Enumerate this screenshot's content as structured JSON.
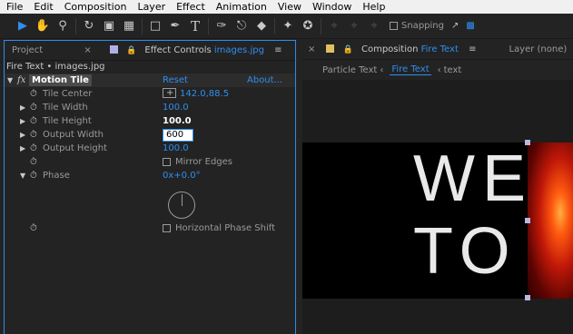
{
  "menu": [
    "File",
    "Edit",
    "Composition",
    "Layer",
    "Effect",
    "Animation",
    "View",
    "Window",
    "Help"
  ],
  "toolbar": {
    "snapping_label": "Snapping"
  },
  "left_panel": {
    "project_tab": "Project",
    "effect_controls_prefix": "Effect Controls",
    "effect_controls_layer": "images.jpg",
    "subheader": "Fire Text • images.jpg",
    "effect": {
      "name": "Motion Tile",
      "reset": "Reset",
      "about": "About..."
    },
    "properties": [
      {
        "label": "Tile Center",
        "value": "142.0,88.5"
      },
      {
        "label": "Tile Width",
        "value": "100.0"
      },
      {
        "label": "Tile Height",
        "value": "100.0"
      },
      {
        "label": "Output Width",
        "value": "600"
      },
      {
        "label": "Output Height",
        "value": "100.0"
      },
      {
        "label": "Mirror Edges"
      },
      {
        "label": "Phase",
        "value": "0x+0.0°"
      },
      {
        "label": "Horizontal Phase Shift"
      }
    ]
  },
  "right_panel": {
    "composition_prefix": "Composition",
    "composition_name": "Fire Text",
    "layer_tab": "Layer (none)",
    "crumbs": [
      "Particle Text",
      "Fire Text",
      "text"
    ],
    "canvas_text_line1": "WE",
    "canvas_text_line2": "TO"
  },
  "colors": {
    "accent": "#2f8ef0",
    "project_swatch": "#b0b0e8",
    "comp_swatch": "#e0c060"
  }
}
